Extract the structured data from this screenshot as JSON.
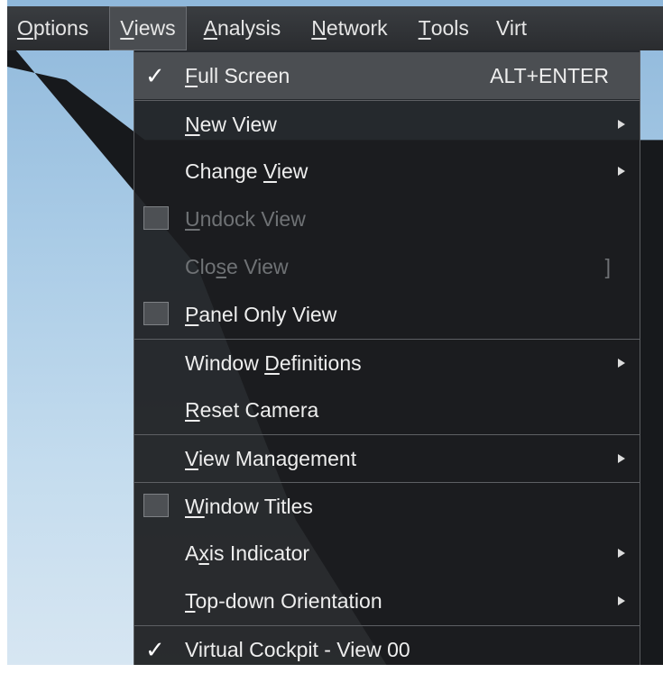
{
  "menubar": {
    "items": [
      {
        "label": "Options",
        "active": false
      },
      {
        "label": "Views",
        "active": true
      },
      {
        "label": "Analysis",
        "active": false
      },
      {
        "label": "Network",
        "active": false
      },
      {
        "label": "Tools",
        "active": false
      },
      {
        "label": "Virt",
        "active": false
      }
    ]
  },
  "views_menu": {
    "items": [
      {
        "label": "Full Screen",
        "shortcut": "ALT+ENTER",
        "checked": true,
        "submenu": false
      },
      {
        "label": "New View",
        "submenu": true
      },
      {
        "label": "Change View",
        "submenu": true
      },
      {
        "label": "Undock View",
        "checkbox": true,
        "disabled": true
      },
      {
        "label": "Close View",
        "shortcut": "]",
        "disabled": true
      },
      {
        "label": "Panel Only View",
        "checkbox": true
      },
      {
        "label": "Window Definitions",
        "submenu": true
      },
      {
        "label": "Reset Camera"
      },
      {
        "label": "View Management",
        "submenu": true
      },
      {
        "label": "Window Titles",
        "checkbox": true
      },
      {
        "label": "Axis Indicator",
        "submenu": true
      },
      {
        "label": "Top-down Orientation",
        "submenu": true
      },
      {
        "label": "Virtual Cockpit - View 00",
        "checked": true
      }
    ]
  },
  "icons": {
    "checkmark": "check-icon",
    "submenu": "submenu-arrow-icon"
  },
  "colors": {
    "menu_background": "#1c1d1f",
    "highlight": "#4b4e52",
    "text": "#eeeeee",
    "disabled_text": "#6f7275"
  }
}
